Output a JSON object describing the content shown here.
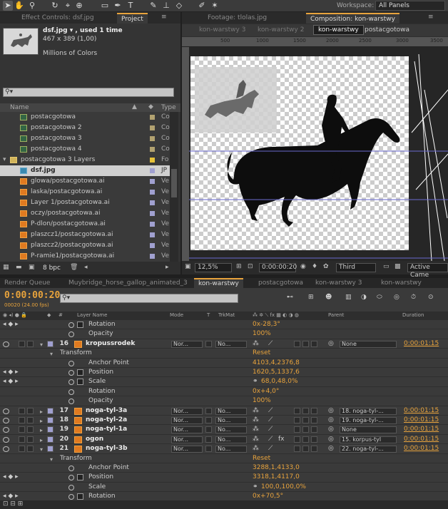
{
  "app": {
    "workspace_label": "Workspace:",
    "workspace_value": "All Panels"
  },
  "left_panel": {
    "tabs": [
      "Effect Controls: dsf.jpg",
      "Project"
    ],
    "selected_item": {
      "name": "dsf.jpg ▾ , used 1 time",
      "size": "467 x 389 (1,00)",
      "colors": "Millions of Colors"
    },
    "search_placeholder": "",
    "columns": {
      "name": "Name",
      "type": "Type"
    },
    "items": [
      {
        "label": "postacgotowa",
        "type": "Co",
        "kind": "comp",
        "swatch": "#b2a270",
        "indent": 1
      },
      {
        "label": "postacgotowa 2",
        "type": "Co",
        "kind": "comp",
        "swatch": "#b2a270",
        "indent": 1
      },
      {
        "label": "postacgotowa 3",
        "type": "Co",
        "kind": "comp",
        "swatch": "#b2a270",
        "indent": 1
      },
      {
        "label": "postacgotowa 4",
        "type": "Co",
        "kind": "comp",
        "swatch": "#b2a270",
        "indent": 1
      },
      {
        "label": "postacgotowa 3 Layers",
        "type": "Fo",
        "kind": "folder",
        "swatch": "#e6c23a",
        "indent": 0
      },
      {
        "label": "dsf.jpg",
        "type": "JP",
        "kind": "jpg",
        "swatch": "#a0a0d0",
        "indent": 1,
        "selected": true
      },
      {
        "label": "glowa/postacgotowa.ai",
        "type": "Ve",
        "kind": "ai",
        "swatch": "#a0a0d0",
        "indent": 1
      },
      {
        "label": "laska/postacgotowa.ai",
        "type": "Ve",
        "kind": "ai",
        "swatch": "#a0a0d0",
        "indent": 1
      },
      {
        "label": "Layer 1/postacgotowa.ai",
        "type": "Ve",
        "kind": "ai",
        "swatch": "#a0a0d0",
        "indent": 1
      },
      {
        "label": "oczy/postacgotowa.ai",
        "type": "Ve",
        "kind": "ai",
        "swatch": "#a0a0d0",
        "indent": 1
      },
      {
        "label": "P-dlon/postacgotowa.ai",
        "type": "Ve",
        "kind": "ai",
        "swatch": "#a0a0d0",
        "indent": 1
      },
      {
        "label": "plaszcz1/postacgotowa.ai",
        "type": "Ve",
        "kind": "ai",
        "swatch": "#a0a0d0",
        "indent": 1
      },
      {
        "label": "plaszcz2/postacgotowa.ai",
        "type": "Ve",
        "kind": "ai",
        "swatch": "#a0a0d0",
        "indent": 1
      },
      {
        "label": "P-ramie1/postacgotowa.ai",
        "type": "Ve",
        "kind": "ai",
        "swatch": "#a0a0d0",
        "indent": 1
      }
    ],
    "footer_bpc": "8 bpc"
  },
  "comp_panel": {
    "tabs": [
      "Footage: tlolas.jpg",
      "Composition: kon-warstwy"
    ],
    "breadcrumbs": [
      "kon-warstwy 3",
      "kon-warstwy 2",
      "kon-warstwy",
      "postacgotowa"
    ],
    "ruler_ticks": [
      "500",
      "1000",
      "1500",
      "2000",
      "2500",
      "3000",
      "3500"
    ],
    "zoom": "12,5%",
    "timecode": "0:00:00:20",
    "resolution": "Third",
    "camera": "Active Came"
  },
  "bottom_tabs": [
    "Render Queue",
    "Muybridge_horse_gallop_animated_3",
    "kon-warstwy",
    "postacgotowa",
    "kon-warstwy 3",
    "kon-warstwy"
  ],
  "timeline": {
    "current_time": "0:00:00:20",
    "fps": "00020 (24.00 fps)",
    "columns": {
      "layer_name": "Layer Name",
      "mode": "Mode",
      "t": "T",
      "trkmat": "TrkMat",
      "parent": "Parent",
      "duration": "Duration",
      "num": "#"
    },
    "rows": [
      {
        "kind": "prop",
        "indent": 2,
        "label": "Rotation",
        "value": "0x-28,3°",
        "keys": true,
        "graph": true
      },
      {
        "kind": "prop",
        "indent": 2,
        "label": "Opacity",
        "value": "100%"
      },
      {
        "kind": "layer",
        "num": "16",
        "label": "kropussrodek",
        "mode": "Nor...",
        "trkmat": "No...",
        "parent": "None",
        "duration": "0:00:01:15",
        "expanded": true
      },
      {
        "kind": "group",
        "indent": 1,
        "label": "Transform",
        "value": "Reset"
      },
      {
        "kind": "prop",
        "indent": 2,
        "label": "Anchor Point",
        "value": "4103,4,2376,8"
      },
      {
        "kind": "prop",
        "indent": 2,
        "label": "Position",
        "value": "1620,5,1337,6",
        "keys": true,
        "graph": true
      },
      {
        "kind": "prop",
        "indent": 2,
        "label": "Scale",
        "value": "68,0,48,0%",
        "keys": true,
        "graph": true,
        "link": true
      },
      {
        "kind": "prop",
        "indent": 2,
        "label": "Rotation",
        "value": "0x+4,0°"
      },
      {
        "kind": "prop",
        "indent": 2,
        "label": "Opacity",
        "value": "100%"
      },
      {
        "kind": "layer",
        "num": "17",
        "label": "noga-tyl-3a",
        "mode": "Nor...",
        "trkmat": "No...",
        "parent": "18. noga-tyl-...",
        "duration": "0:00:01:15"
      },
      {
        "kind": "layer",
        "num": "18",
        "label": "noga-tyl-2a",
        "mode": "Nor...",
        "trkmat": "No...",
        "parent": "19. noga-tyl-...",
        "duration": "0:00:01:15"
      },
      {
        "kind": "layer",
        "num": "19",
        "label": "noga-tyl-1a",
        "mode": "Nor...",
        "trkmat": "No...",
        "parent": "None",
        "duration": "0:00:01:15"
      },
      {
        "kind": "layer",
        "num": "20",
        "label": "ogon",
        "mode": "Nor...",
        "trkmat": "No...",
        "parent": "15. korpus-tyl",
        "duration": "0:00:01:15",
        "fx": true
      },
      {
        "kind": "layer",
        "num": "21",
        "label": "noga-tyl-3b",
        "mode": "Nor...",
        "trkmat": "No...",
        "parent": "22. noga-tyl-...",
        "duration": "0:00:01:15",
        "expanded": true
      },
      {
        "kind": "group",
        "indent": 1,
        "label": "Transform",
        "value": "Reset"
      },
      {
        "kind": "prop",
        "indent": 2,
        "label": "Anchor Point",
        "value": "3288,1,4133,0"
      },
      {
        "kind": "prop",
        "indent": 2,
        "label": "Position",
        "value": "3318,1,4117,0",
        "keys": true,
        "graph": true
      },
      {
        "kind": "prop",
        "indent": 2,
        "label": "Scale",
        "value": "100,0,100,0%",
        "link": true
      },
      {
        "kind": "prop",
        "indent": 2,
        "label": "Rotation",
        "value": "0x+70,5°",
        "keys": true,
        "graph": true
      }
    ]
  },
  "colors": {
    "accent": "#e8a33c",
    "panel": "#3a3a3a",
    "dark": "#262626"
  }
}
